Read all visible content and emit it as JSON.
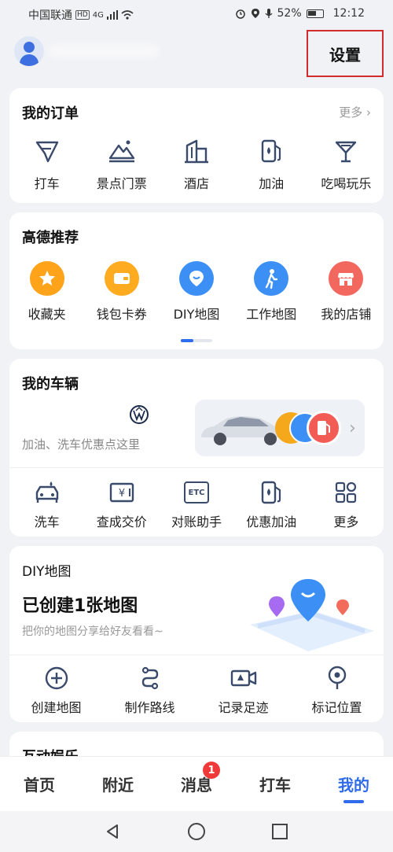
{
  "status_bar": {
    "carrier": "中国联通",
    "hd": "HD",
    "network": "4G",
    "battery": "52%",
    "time": "12:12"
  },
  "header": {
    "settings_label": "设置"
  },
  "orders": {
    "title": "我的订单",
    "more": "更多",
    "items": [
      {
        "label": "打车",
        "icon": "taxi-icon"
      },
      {
        "label": "景点门票",
        "icon": "scenic-icon"
      },
      {
        "label": "酒店",
        "icon": "hotel-icon"
      },
      {
        "label": "加油",
        "icon": "fuel-icon"
      },
      {
        "label": "吃喝玩乐",
        "icon": "cocktail-icon"
      }
    ]
  },
  "recommend": {
    "title": "高德推荐",
    "items": [
      {
        "label": "收藏夹",
        "icon": "star-icon",
        "color": "#ffa31a"
      },
      {
        "label": "钱包卡券",
        "icon": "wallet-icon",
        "color": "#ffab1f"
      },
      {
        "label": "DIY地图",
        "icon": "diy-map-icon",
        "color": "#3b8ff5"
      },
      {
        "label": "工作地图",
        "icon": "walker-icon",
        "color": "#3b8ff5"
      },
      {
        "label": "我的店铺",
        "icon": "shop-icon",
        "color": "#f2685e"
      }
    ]
  },
  "vehicle": {
    "title": "我的车辆",
    "subtitle": "加油、洗车优惠点这里",
    "items": [
      {
        "label": "洗车",
        "icon": "car-wash-icon"
      },
      {
        "label": "查成交价",
        "icon": "price-icon"
      },
      {
        "label": "对账助手",
        "icon": "etc-icon"
      },
      {
        "label": "优惠加油",
        "icon": "fuel-icon"
      },
      {
        "label": "更多",
        "icon": "grid-icon"
      }
    ],
    "etc_text": "ETC"
  },
  "diy": {
    "title": "DIY地图",
    "headline": "已创建1张地图",
    "subtitle": "把你的地图分享给好友看看~",
    "items": [
      {
        "label": "创建地图",
        "icon": "plus-circle-icon"
      },
      {
        "label": "制作路线",
        "icon": "route-icon"
      },
      {
        "label": "记录足迹",
        "icon": "camera-icon"
      },
      {
        "label": "标记位置",
        "icon": "pin-icon"
      }
    ]
  },
  "next_section": {
    "title": "互动娱乐"
  },
  "tabs": [
    {
      "label": "首页",
      "active": false
    },
    {
      "label": "附近",
      "active": false
    },
    {
      "label": "消息",
      "active": false,
      "badge": "1"
    },
    {
      "label": "打车",
      "active": false
    },
    {
      "label": "我的",
      "active": true
    }
  ],
  "colors": {
    "accent": "#2f6bed",
    "badge": "#f03a3a",
    "highlight_border": "#d12b2b"
  }
}
